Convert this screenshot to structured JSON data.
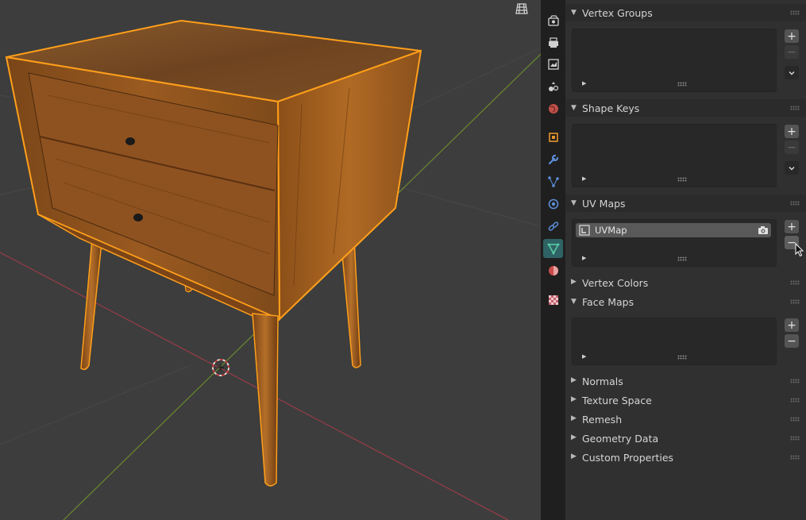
{
  "viewport": {
    "overlay_button_icon": "grid-overlay-icon",
    "object_outline_color": "#ff9f1a",
    "axis_x_color": "#9a3c48",
    "axis_y_color": "#6b8a2e"
  },
  "tabs": [
    {
      "name": "render-icon"
    },
    {
      "name": "output-icon"
    },
    {
      "name": "view-layer-icon"
    },
    {
      "name": "scene-icon"
    },
    {
      "name": "world-icon"
    },
    {
      "name": "object-icon"
    },
    {
      "name": "modifier-wrench-icon"
    },
    {
      "name": "particles-icon"
    },
    {
      "name": "physics-icon"
    },
    {
      "name": "constraints-icon"
    },
    {
      "name": "object-data-mesh-icon",
      "active": true
    },
    {
      "name": "material-icon"
    },
    {
      "name": "texture-checker-icon"
    }
  ],
  "panels": {
    "vertex_groups": {
      "title": "Vertex Groups",
      "add": "+",
      "remove": "−"
    },
    "shape_keys": {
      "title": "Shape Keys",
      "add": "+",
      "remove": "−"
    },
    "uv_maps": {
      "title": "UV Maps",
      "item_label": "UVMap",
      "add": "+",
      "remove": "−"
    },
    "vertex_colors": {
      "title": "Vertex Colors"
    },
    "face_maps": {
      "title": "Face Maps",
      "add": "+",
      "remove": "−"
    },
    "normals": {
      "title": "Normals"
    },
    "texture_space": {
      "title": "Texture Space"
    },
    "remesh": {
      "title": "Remesh"
    },
    "geometry_data": {
      "title": "Geometry Data"
    },
    "custom_properties": {
      "title": "Custom Properties"
    }
  }
}
